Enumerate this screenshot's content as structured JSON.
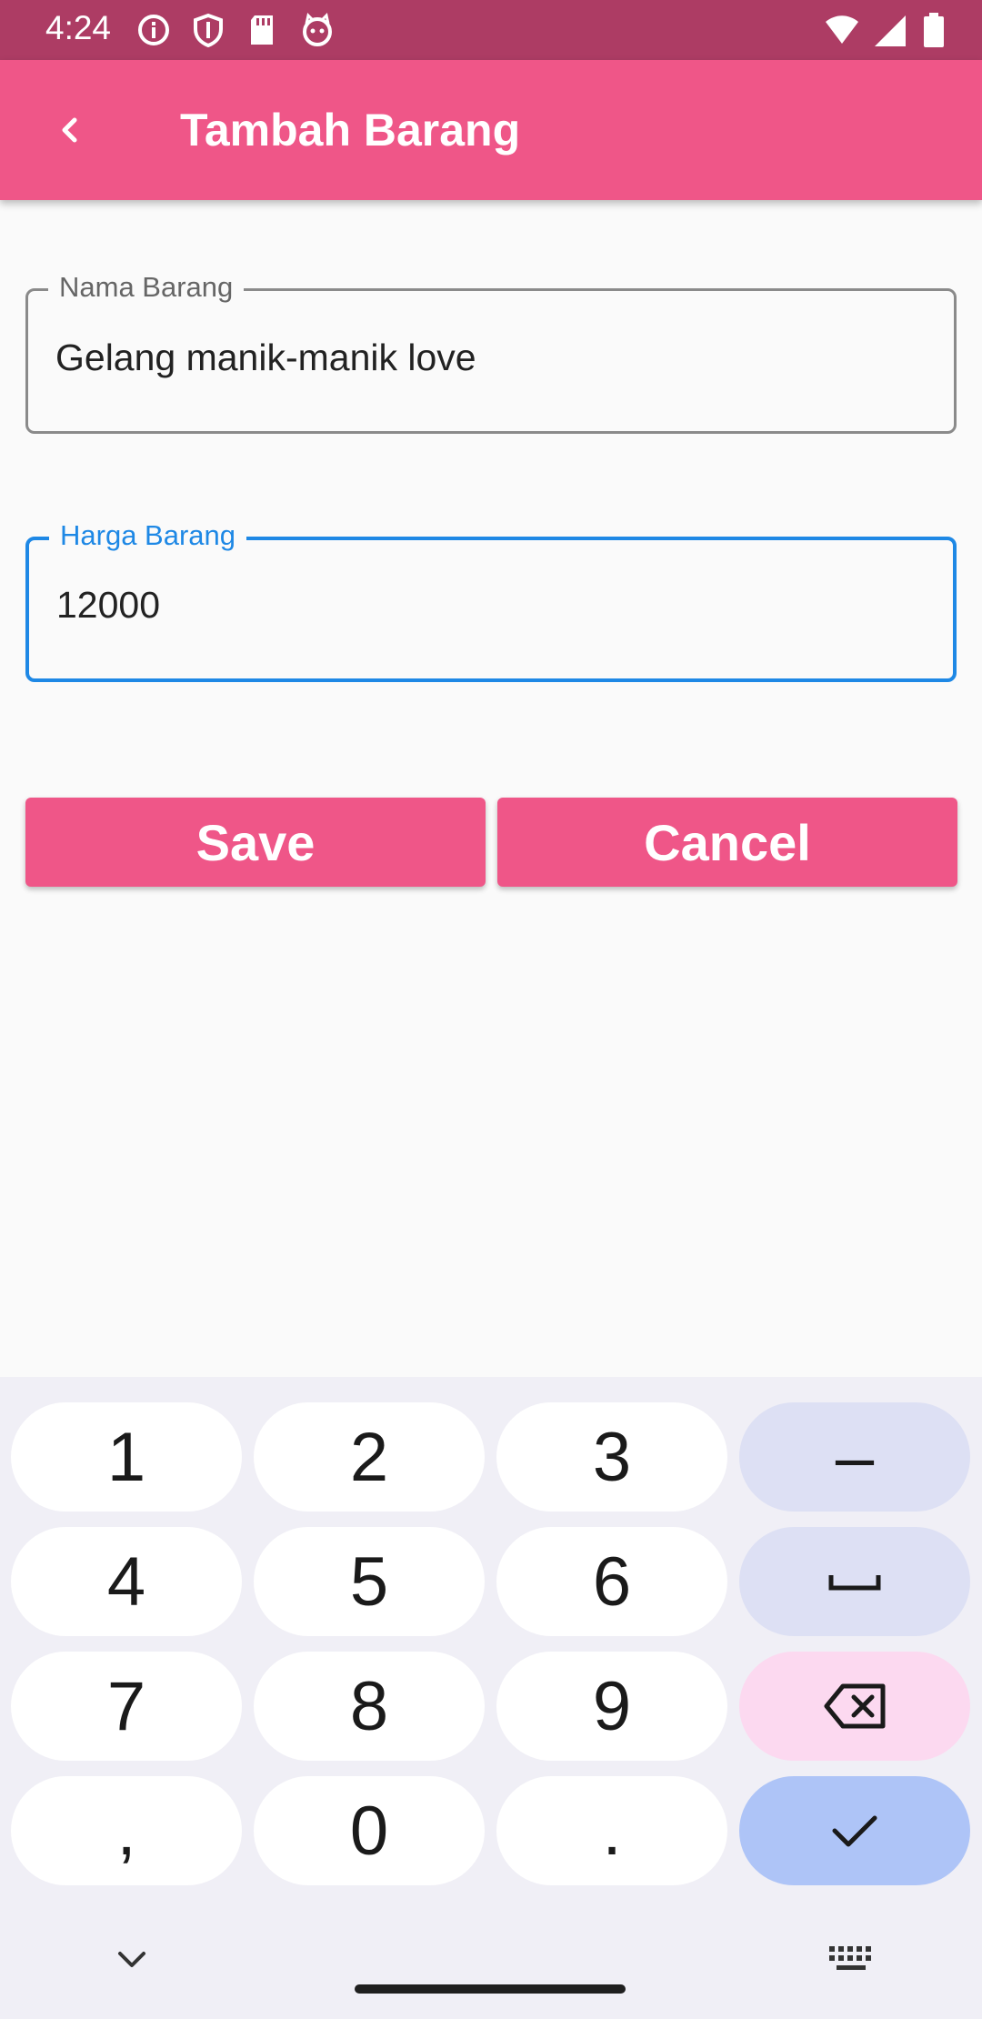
{
  "status_bar": {
    "time": "4:24",
    "left_icons": [
      "info-icon",
      "shield-icon",
      "sd-card-icon",
      "cat-face-icon"
    ],
    "right_icons": [
      "wifi-icon",
      "signal-icon",
      "battery-icon"
    ]
  },
  "app_bar": {
    "title": "Tambah Barang",
    "back_icon": "chevron-left-icon",
    "color": "#ef5688"
  },
  "form": {
    "nama_barang": {
      "label": "Nama Barang",
      "value": "Gelang manik-manik love"
    },
    "harga_barang": {
      "label": "Harga Barang",
      "value": "12000",
      "focused": true
    },
    "save_label": "Save",
    "cancel_label": "Cancel"
  },
  "keyboard": {
    "rows": [
      [
        "1",
        "2",
        "3",
        "–"
      ],
      [
        "4",
        "5",
        "6",
        "space-icon"
      ],
      [
        "7",
        "8",
        "9",
        "backspace-icon"
      ],
      [
        ",",
        "0",
        ".",
        "check-icon"
      ]
    ],
    "bottom_left_icon": "chevron-down-icon",
    "bottom_right_icon": "keyboard-icon"
  },
  "colors": {
    "primary": "#ef5688",
    "status_bar": "#ad3c64",
    "focus": "#1e88e5"
  }
}
